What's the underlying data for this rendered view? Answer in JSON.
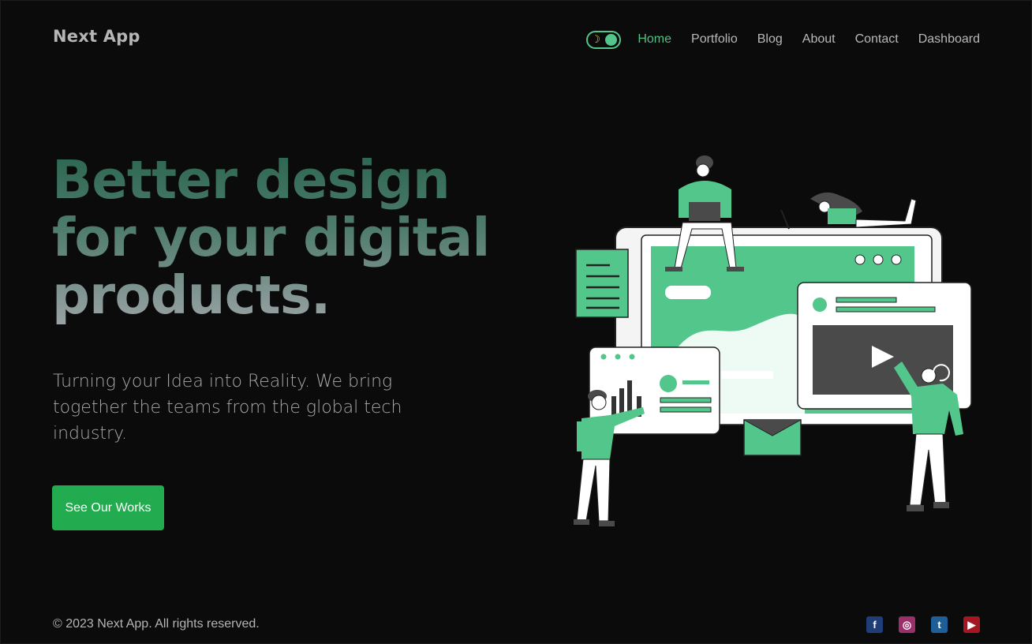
{
  "brand": {
    "name": "Next App"
  },
  "theme_toggle": {
    "icon": "moon-icon",
    "accent": "#53c68c"
  },
  "nav": {
    "items": [
      {
        "label": "Home",
        "active": true
      },
      {
        "label": "Portfolio"
      },
      {
        "label": "Blog"
      },
      {
        "label": "About"
      },
      {
        "label": "Contact"
      },
      {
        "label": "Dashboard"
      }
    ]
  },
  "hero": {
    "title_lines": [
      "Better design",
      "for your digital",
      "products."
    ],
    "subtitle": "Turning your Idea into Reality. We bring together the teams from the global tech industry.",
    "cta_label": "See Our Works"
  },
  "footer": {
    "copyright": "© 2023 Next App. All rights reserved.",
    "social": [
      {
        "name": "facebook-icon",
        "color": "#1f3e78"
      },
      {
        "name": "instagram-icon",
        "color": "#9b2f6a"
      },
      {
        "name": "twitter-icon",
        "color": "#1d5f96"
      },
      {
        "name": "youtube-icon",
        "color": "#a31622"
      }
    ]
  },
  "colors": {
    "accent": "#22ab4f",
    "background": "#0b0b0b"
  }
}
